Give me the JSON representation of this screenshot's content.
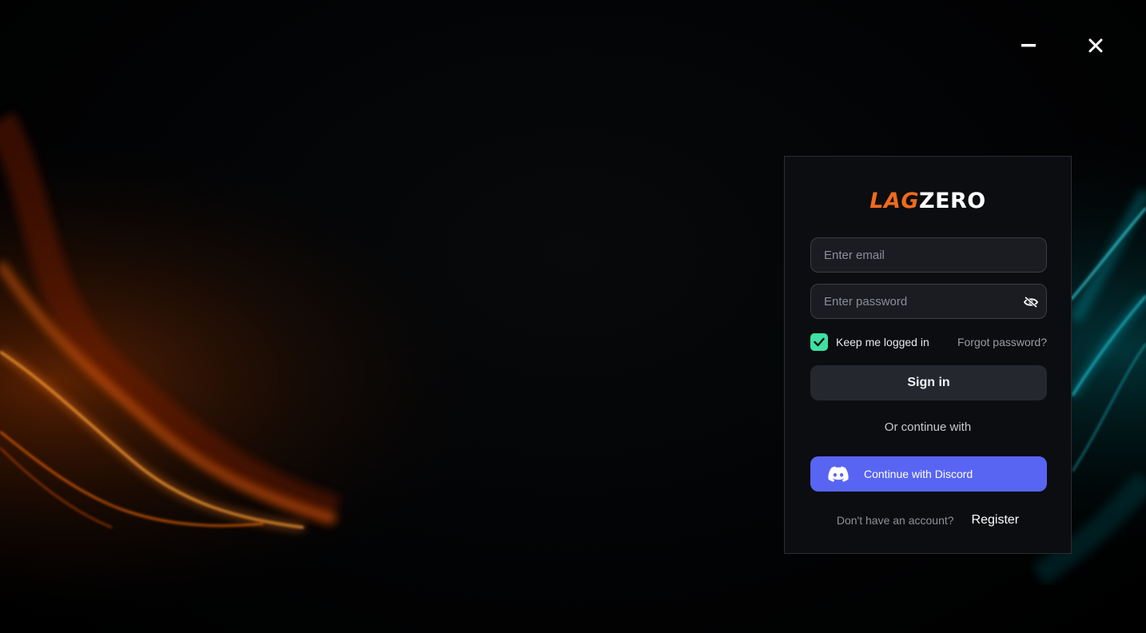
{
  "window": {
    "minimize_icon": "minimize-icon",
    "close_icon": "close-icon"
  },
  "logo": {
    "lag": "LAG",
    "zero": "ZERO"
  },
  "login": {
    "email_placeholder": "Enter email",
    "email_value": "",
    "password_placeholder": "Enter password",
    "password_value": "",
    "password_toggle_icon": "eye-off-icon",
    "remember_label": "Keep me logged in",
    "remember_checked": true,
    "forgot_label": "Forgot password?",
    "signin_label": "Sign in",
    "or_label": "Or continue with",
    "discord_label": "Continue with Discord",
    "no_account_label": "Don't have an account?",
    "register_label": "Register"
  },
  "colors": {
    "accent_green": "#3ee0a4",
    "discord_blue": "#5865f2",
    "brand_orange": "#f06a1d",
    "panel_bg": "#0c0d10"
  }
}
